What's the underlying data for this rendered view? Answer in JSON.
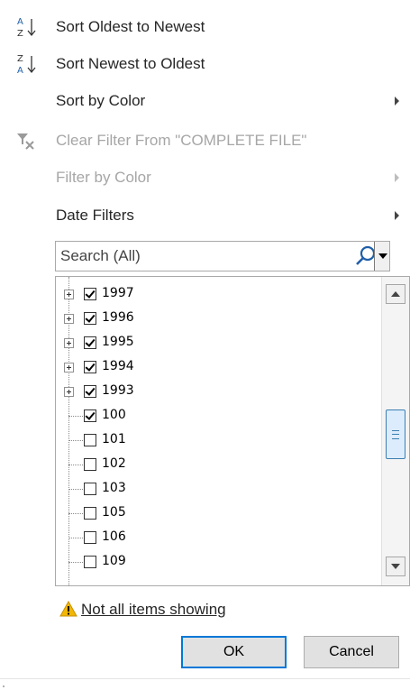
{
  "menu": {
    "sort_oldest": {
      "label": "Sort Oldest to Newest",
      "icon": "sort-ascending-icon"
    },
    "sort_newest": {
      "label": "Sort Newest to Oldest",
      "icon": "sort-descending-icon"
    },
    "sort_color": {
      "label": "Sort by Color"
    },
    "clear_filter": {
      "label": "Clear Filter From \"COMPLETE FILE\"",
      "icon": "clear-filter-icon"
    },
    "filter_color": {
      "label": "Filter by Color"
    },
    "date_filters": {
      "label": "Date Filters"
    }
  },
  "search": {
    "value": "",
    "placeholder": "Search (All)"
  },
  "tree": {
    "items": [
      {
        "label": "1997",
        "checked": true,
        "expandable": true
      },
      {
        "label": "1996",
        "checked": true,
        "expandable": true
      },
      {
        "label": "1995",
        "checked": true,
        "expandable": true
      },
      {
        "label": "1994",
        "checked": true,
        "expandable": true
      },
      {
        "label": "1993",
        "checked": true,
        "expandable": true
      },
      {
        "label": "100",
        "checked": true,
        "expandable": false
      },
      {
        "label": "101",
        "checked": false,
        "expandable": false
      },
      {
        "label": "102",
        "checked": false,
        "expandable": false
      },
      {
        "label": "103",
        "checked": false,
        "expandable": false
      },
      {
        "label": "105",
        "checked": false,
        "expandable": false
      },
      {
        "label": "106",
        "checked": false,
        "expandable": false
      },
      {
        "label": "109",
        "checked": false,
        "expandable": false
      }
    ]
  },
  "warning": {
    "text": "Not all items showing",
    "color": "#f2b705"
  },
  "buttons": {
    "ok": "OK",
    "cancel": "Cancel"
  },
  "colors": {
    "accent": "#0078d7",
    "disabled_text": "#a6a6a6",
    "text": "#262626"
  }
}
